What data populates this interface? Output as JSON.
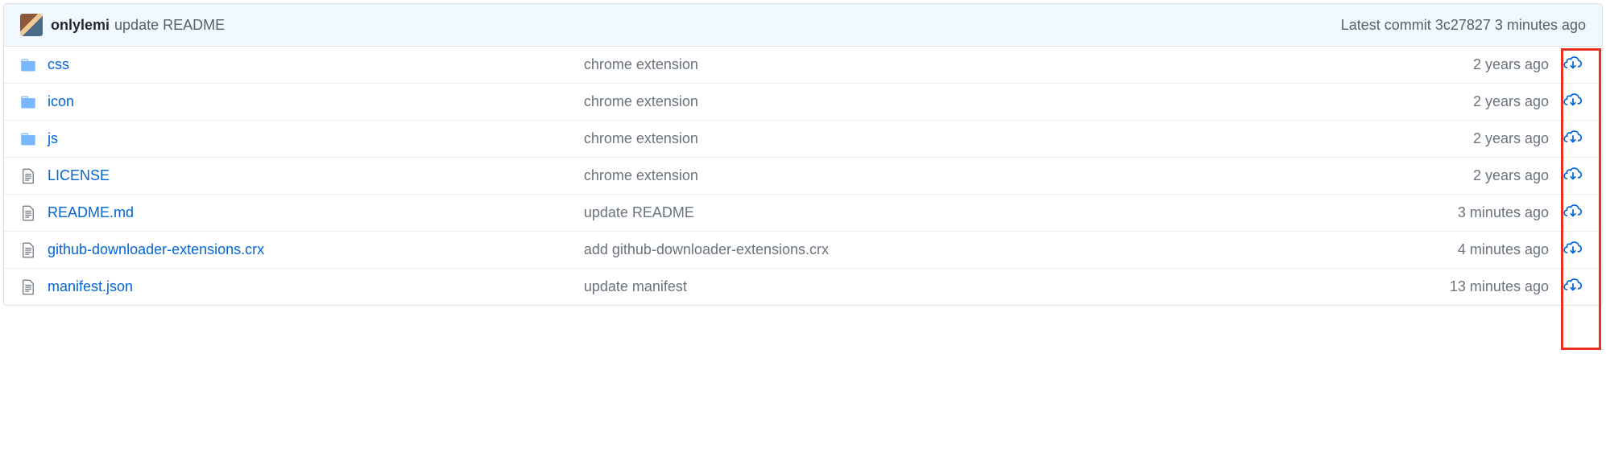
{
  "commit": {
    "author": "onlylemi",
    "message": "update README",
    "latest_label": "Latest commit",
    "sha": "3c27827",
    "age": "3 minutes ago"
  },
  "files": [
    {
      "type": "folder",
      "name": "css",
      "message": "chrome extension",
      "age": "2 years ago"
    },
    {
      "type": "folder",
      "name": "icon",
      "message": "chrome extension",
      "age": "2 years ago"
    },
    {
      "type": "folder",
      "name": "js",
      "message": "chrome extension",
      "age": "2 years ago"
    },
    {
      "type": "file",
      "name": "LICENSE",
      "message": "chrome extension",
      "age": "2 years ago"
    },
    {
      "type": "file",
      "name": "README.md",
      "message": "update README",
      "age": "3 minutes ago"
    },
    {
      "type": "file",
      "name": "github-downloader-extensions.crx",
      "message": "add github-downloader-extensions.crx",
      "age": "4 minutes ago"
    },
    {
      "type": "file",
      "name": "manifest.json",
      "message": "update manifest",
      "age": "13 minutes ago"
    }
  ]
}
